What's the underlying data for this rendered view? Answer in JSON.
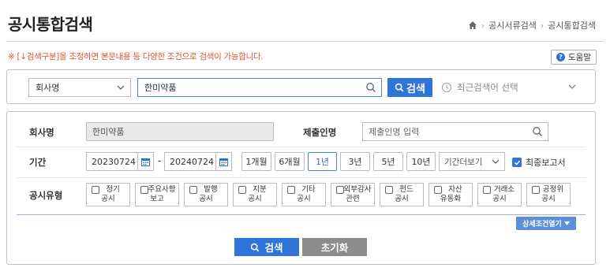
{
  "header": {
    "title": "공시통합검색",
    "breadcrumb": [
      "공시서류검색",
      "공시통합검색"
    ]
  },
  "notice": "※ [↓검색구분]을 조정하면 본문내용 등 다양한 조건으로 검색이 가능합니다.",
  "help_label": "도움말",
  "search": {
    "type_selected": "회사명",
    "query_value": "한미약품",
    "search_label": "검색",
    "recent_placeholder": "최근검색어 선택"
  },
  "filters": {
    "company_label": "회사명",
    "company_value": "한미약품",
    "submitter_label": "제출인명",
    "submitter_placeholder": "제출인명 입력",
    "period_label": "기간",
    "date_from": "20230724",
    "date_dash": "-",
    "date_to": "20240724",
    "period_buttons": [
      "1개월",
      "6개월",
      "1년",
      "3년",
      "5년",
      "10년"
    ],
    "period_active": "1년",
    "more_period": "기간더보기",
    "final_report_label": "최종보고서",
    "final_report_checked": true,
    "disclosure_type_label": "공시유형",
    "disclosure_types": [
      [
        "정기",
        "공시"
      ],
      [
        "주요사항",
        "보고"
      ],
      [
        "발행",
        "공시"
      ],
      [
        "지분",
        "공시"
      ],
      [
        "기타",
        "공시"
      ],
      [
        "외부감사",
        "관련"
      ],
      [
        "펀드",
        "공시"
      ],
      [
        "자산",
        "유동화"
      ],
      [
        "거래소",
        "공시"
      ],
      [
        "공정위",
        "공시"
      ]
    ],
    "detail_toggle": "상세조건열기"
  },
  "actions": {
    "search": "검색",
    "reset": "초기화"
  },
  "colors": {
    "primary": "#2f74d8",
    "notice": "#e5532d",
    "reset": "#8c8c8c"
  }
}
